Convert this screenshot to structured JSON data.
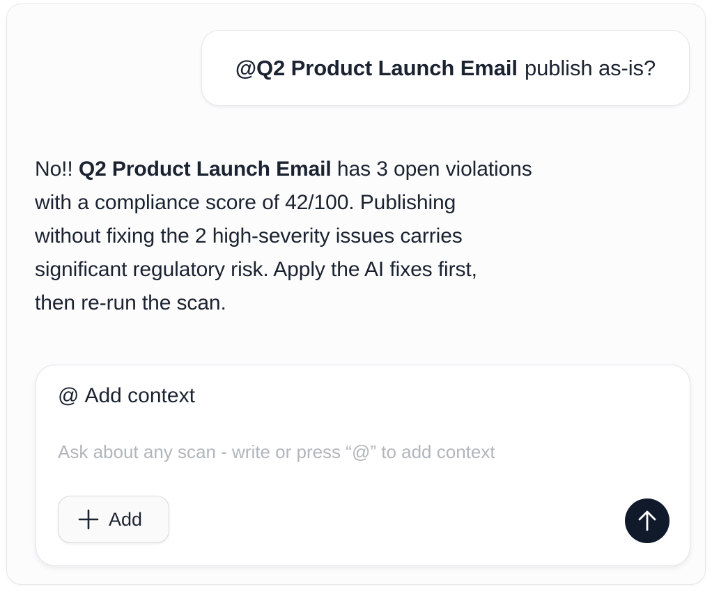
{
  "user_message": {
    "mention": "@Q2 Product Launch Email",
    "text": "publish as-is?"
  },
  "assistant_message": {
    "line1_prefix": "No!!",
    "line1_bold": "Q2 Product Launch Email",
    "line1_suffix": "has 3 open violations",
    "line2": "with a compliance score of 42/100. Publishing",
    "line3": "without fixing the 2 high-severity issues carries",
    "line4": "significant regulatory risk. Apply the AI fixes first,",
    "line5": "then re-run the scan."
  },
  "composer": {
    "context_label": "Add context",
    "context_icon": "@",
    "input_value": "",
    "input_placeholder": "Ask about any scan - write or press “@” to add context",
    "add_label": "Add",
    "add_icon": "plus-icon",
    "send_icon": "arrow-up-icon"
  },
  "colors": {
    "text": "#1b2230",
    "send_button": "#111a2b",
    "placeholder": "#b2b5bb"
  }
}
